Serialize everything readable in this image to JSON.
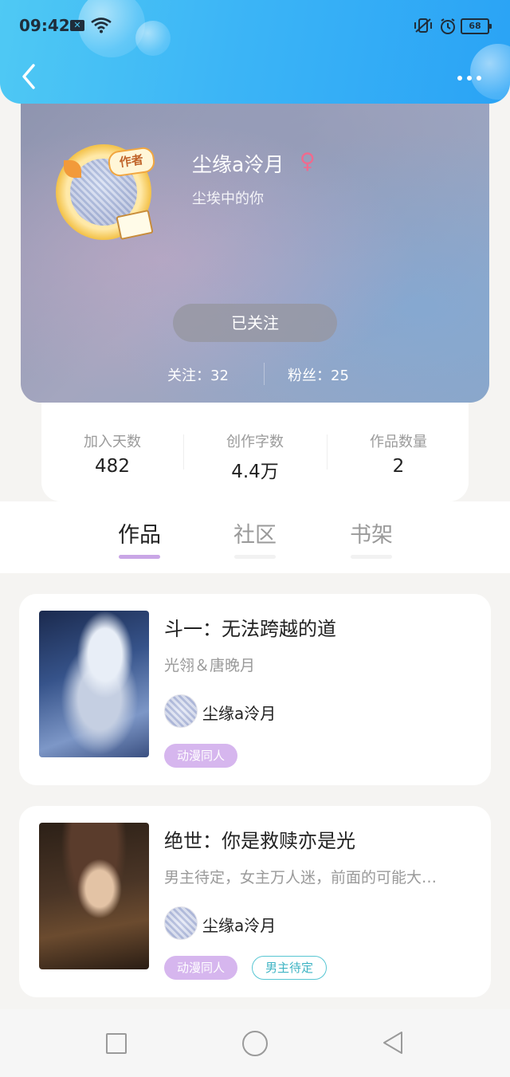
{
  "status_bar": {
    "time": "09:42",
    "sim_label": "✕",
    "battery": "68"
  },
  "header": {
    "back_icon": "chevron-left-icon",
    "more_icon": "more-dots-icon"
  },
  "profile": {
    "name": "尘缘a泠月",
    "gender_icon": "female-icon",
    "gender_symbol": "♀",
    "signature": "尘埃中的你",
    "author_badge": "作者",
    "follow_button": "已关注",
    "following": "关注：32",
    "fans": "粉丝：25"
  },
  "stats": [
    {
      "label": "加入天数",
      "value": "482"
    },
    {
      "label": "创作字数",
      "value": "4.4万"
    },
    {
      "label": "作品数量",
      "value": "2"
    }
  ],
  "tabs": [
    {
      "label": "作品",
      "active": true
    },
    {
      "label": "社区",
      "active": false
    },
    {
      "label": "书架",
      "active": false
    }
  ],
  "works": [
    {
      "title": "斗一：无法跨越的道",
      "description": "光翎＆唐晚月",
      "author": "尘缘a泠月",
      "tags": [
        "动漫同人"
      ]
    },
    {
      "title": "绝世：你是救赎亦是光",
      "description": "男主待定，女主万人迷，前面的可能大…",
      "author": "尘缘a泠月",
      "tags": [
        "动漫同人",
        "男主待定"
      ]
    }
  ],
  "colors": {
    "header_blue": "#3cb5f6",
    "tab_accent": "#c9a6e6",
    "tag_purple": "#d6b6ee",
    "tag_cyan": "#57c6d3",
    "gender_pink": "#f06a8e"
  }
}
